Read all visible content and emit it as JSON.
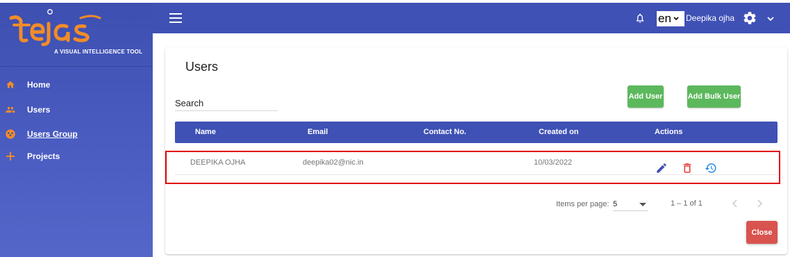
{
  "logo": {
    "brand": "tejas",
    "tagline": "A VISUAL INTELLIGENCE TOOL"
  },
  "sidebar": {
    "items": [
      {
        "label": "Home",
        "icon": "home-icon"
      },
      {
        "label": "Users",
        "icon": "people-icon"
      },
      {
        "label": "Users Group",
        "icon": "group-icon"
      },
      {
        "label": "Projects",
        "icon": "plus-icon"
      }
    ]
  },
  "topbar": {
    "language": "en",
    "user_name": "Deepika ojha"
  },
  "page": {
    "title": "Users",
    "search_placeholder": "Search",
    "add_user_label": "Add User",
    "add_bulk_user_label": "Add Bulk User",
    "close_label": "Close"
  },
  "table": {
    "columns": [
      "Name",
      "Email",
      "Contact No.",
      "Created on",
      "Actions"
    ],
    "rows": [
      {
        "name": "DEEPIKA OJHA",
        "email": "deepika02@nic.in",
        "contact": "",
        "created_on": "10/03/2022"
      }
    ]
  },
  "paginator": {
    "items_per_page_label": "Items per page:",
    "page_size": "5",
    "range": "1 – 1 of 1"
  },
  "colors": {
    "primary": "#3f51b5",
    "success": "#5cb85c",
    "danger": "#d9534f",
    "accent_orange": "#f28c28",
    "highlight": "#e00000"
  }
}
